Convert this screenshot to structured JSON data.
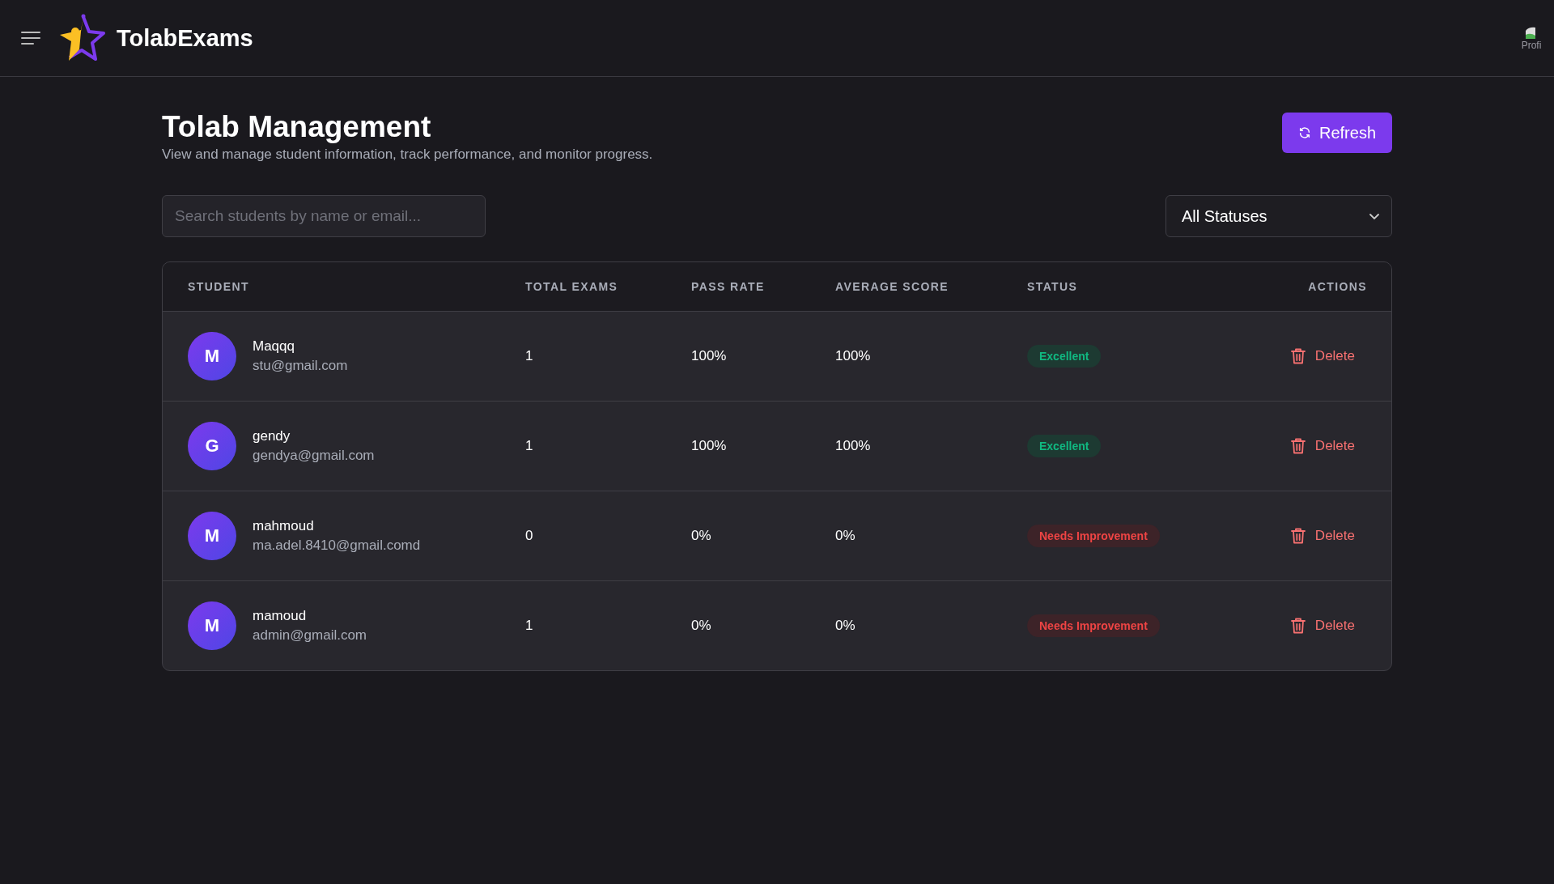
{
  "header": {
    "brand": "TolabExams",
    "profile_alt": "Profi"
  },
  "page": {
    "title": "Tolab Management",
    "subtitle": "View and manage student information, track performance, and monitor progress.",
    "refresh_button": "Refresh"
  },
  "search": {
    "placeholder": "Search students by name or email..."
  },
  "status_filter": {
    "value": "All Statuses"
  },
  "table": {
    "columns": [
      "STUDENT",
      "TOTAL EXAMS",
      "PASS RATE",
      "AVERAGE SCORE",
      "STATUS",
      "ACTIONS"
    ],
    "rows": [
      {
        "initial": "M",
        "name": "Maqqq",
        "email": "stu@gmail.com",
        "total_exams": "1",
        "pass_rate": "100%",
        "average_score": "100%",
        "status": {
          "text": "Excellent",
          "kind": "excellent"
        },
        "action": "Delete"
      },
      {
        "initial": "G",
        "name": "gendy",
        "email": "gendya@gmail.com",
        "total_exams": "1",
        "pass_rate": "100%",
        "average_score": "100%",
        "status": {
          "text": "Excellent",
          "kind": "excellent"
        },
        "action": "Delete"
      },
      {
        "initial": "M",
        "name": "mahmoud",
        "email": "ma.adel.8410@gmail.comd",
        "total_exams": "0",
        "pass_rate": "0%",
        "average_score": "0%",
        "status": {
          "text": "Needs Improvement",
          "kind": "poor"
        },
        "action": "Delete"
      },
      {
        "initial": "M",
        "name": "mamoud",
        "email": "admin@gmail.com",
        "total_exams": "1",
        "pass_rate": "0%",
        "average_score": "0%",
        "status": {
          "text": "Needs Improvement",
          "kind": "poor"
        },
        "action": "Delete"
      }
    ]
  }
}
